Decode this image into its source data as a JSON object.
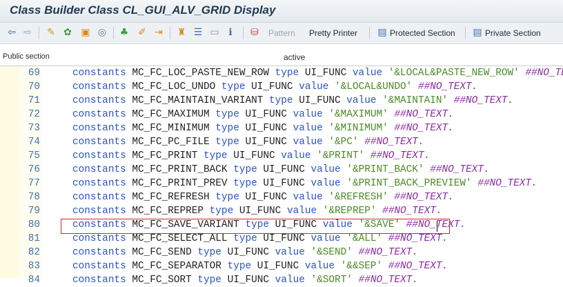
{
  "window": {
    "title": "Class Builder Class CL_GUI_ALV_GRID Display"
  },
  "toolbar": {
    "pattern_label": "Pattern",
    "pretty_printer_label": "Pretty Printer",
    "protected_section_label": "Protected Section",
    "private_section_label": "Private Section",
    "icons": [
      "back-icon",
      "forward-icon",
      "other-object-icon",
      "check-icon",
      "activate-icon",
      "test-icon",
      "hierarchy-icon",
      "edit-icon",
      "where-used-icon",
      "hierarchy-tree-icon",
      "display-list-icon",
      "window-icon",
      "info-icon",
      "pattern-icon"
    ]
  },
  "status": {
    "section": "Public section",
    "state": "active"
  },
  "editor": {
    "highlighted_line": 80,
    "lines": [
      {
        "num": "69",
        "name": "MC_FC_LOC_PASTE_NEW_ROW",
        "value": "'&LOCAL&PASTE_NEW_ROW'",
        "comment": "##NO_TEXT."
      },
      {
        "num": "70",
        "name": "MC_FC_LOC_UNDO",
        "value": "'&LOCAL&UNDO'",
        "comment": "##NO_TEXT."
      },
      {
        "num": "71",
        "name": "MC_FC_MAINTAIN_VARIANT",
        "value": "'&MAINTAIN'",
        "comment": "##NO_TEXT."
      },
      {
        "num": "72",
        "name": "MC_FC_MAXIMUM",
        "value": "'&MAXIMUM'",
        "comment": "##NO_TEXT."
      },
      {
        "num": "73",
        "name": "MC_FC_MINIMUM",
        "value": "'&MINIMUM'",
        "comment": "##NO_TEXT."
      },
      {
        "num": "74",
        "name": "MC_FC_PC_FILE",
        "value": "'&PC'",
        "comment": "##NO_TEXT."
      },
      {
        "num": "75",
        "name": "MC_FC_PRINT",
        "value": "'&PRINT'",
        "comment": "##NO_TEXT."
      },
      {
        "num": "76",
        "name": "MC_FC_PRINT_BACK",
        "value": "'&PRINT_BACK'",
        "comment": "##NO_TEXT."
      },
      {
        "num": "77",
        "name": "MC_FC_PRINT_PREV",
        "value": "'&PRINT_BACK_PREVIEW'",
        "comment": "##NO_TEXT."
      },
      {
        "num": "78",
        "name": "MC_FC_REFRESH",
        "value": "'&REFRESH'",
        "comment": "##NO_TEXT."
      },
      {
        "num": "79",
        "name": "MC_FC_REPREP",
        "value": "'&REPREP'",
        "comment": "##NO_TEXT."
      },
      {
        "num": "80",
        "name": "MC_FC_SAVE_VARIANT",
        "value": "'&SAVE'",
        "comment": "##NO_TEXT."
      },
      {
        "num": "81",
        "name": "MC_FC_SELECT_ALL",
        "value": "'&ALL'",
        "comment": "##NO_TEXT."
      },
      {
        "num": "82",
        "name": "MC_FC_SEND",
        "value": "'&SEND'",
        "comment": "##NO_TEXT."
      },
      {
        "num": "83",
        "name": "MC_FC_SEPARATOR",
        "value": "'&&SEP'",
        "comment": "##NO_TEXT."
      },
      {
        "num": "84",
        "name": "MC_FC_SORT",
        "value": "'&SORT'",
        "comment": "##NO_TEXT."
      }
    ],
    "keyword_constants": "constants",
    "keyword_type": "type",
    "type_name": "UI_FUNC",
    "keyword_value": "value"
  },
  "colors": {
    "keyword": "#2a52c8",
    "string": "#4b8a26",
    "comment": "#8a2aa0",
    "highlight_border": "#d12727",
    "line_number": "#3d6fa6"
  }
}
